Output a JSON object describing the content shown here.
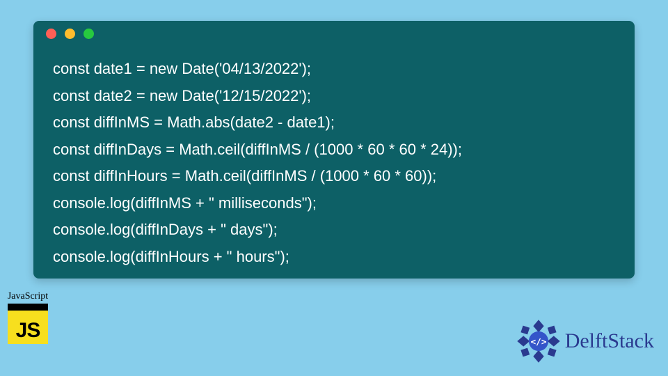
{
  "code": {
    "lines": [
      "const date1 = new Date('04/13/2022');",
      "const date2 = new Date('12/15/2022');",
      "const diffInMS = Math.abs(date2 - date1);",
      "const diffInDays = Math.ceil(diffInMS / (1000 * 60 * 60 * 24));",
      "const diffInHours = Math.ceil(diffInMS / (1000 * 60 * 60));",
      "console.log(diffInMS + \" milliseconds\");",
      "console.log(diffInDays + \" days\");",
      "console.log(diffInHours + \" hours\");"
    ]
  },
  "js_badge": {
    "label": "JavaScript",
    "logo_text": "JS"
  },
  "brand": {
    "name": "DelftStack"
  },
  "colors": {
    "page_bg": "#87ceeb",
    "window_bg": "#0d6066",
    "code_text": "#ffffff",
    "js_yellow": "#f7df1e",
    "brand_blue": "#2a3a8f"
  }
}
